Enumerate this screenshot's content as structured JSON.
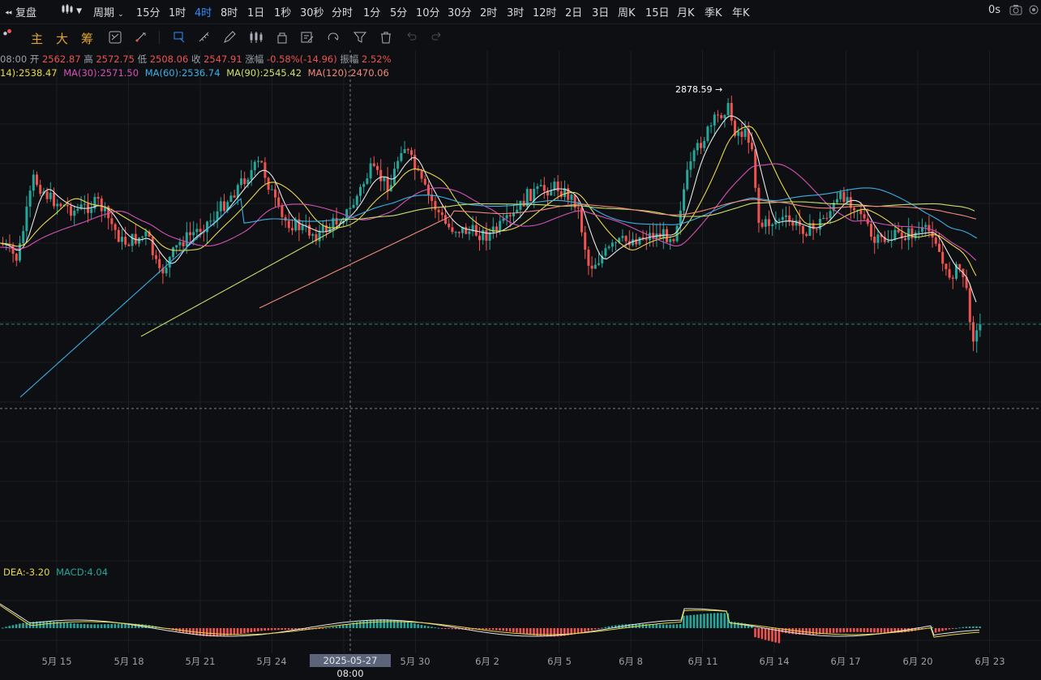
{
  "topbar": {
    "replay": "复盘",
    "period": "周期",
    "intervals": [
      "15分",
      "1时",
      "4时",
      "8时",
      "1日",
      "1秒",
      "30秒",
      "分时",
      "1分",
      "5分",
      "10分",
      "30分",
      "2时",
      "3时",
      "12时",
      "2日",
      "3日",
      "周K",
      "15日",
      "月K",
      "季K",
      "年K"
    ],
    "active_interval": "4时",
    "latency": "0s"
  },
  "toolbar": {
    "indicator_main": "主",
    "indicator_big": "大",
    "indicator_chip": "筹"
  },
  "info": {
    "time": "08:00",
    "open_label": "开",
    "open": "2562.87",
    "high_label": "高",
    "high": "2572.75",
    "low_label": "低",
    "low": "2508.06",
    "close_label": "收",
    "close": "2547.91",
    "chg_label": "涨幅",
    "chg": "-0.58%(-14.96)",
    "amp_label": "振幅",
    "amp": "2.52%"
  },
  "ma": {
    "ma_partial": "14):2538.47",
    "ma30": "MA(30):2571.50",
    "ma60": "MA(60):2536.74",
    "ma90": "MA(90):2545.42",
    "ma120": "MA(120):2470.06"
  },
  "macd": {
    "dea": "DEA:-3.20",
    "macd": "MACD:4.04"
  },
  "high_marker": "2878.59",
  "crosshair_time": "2025-05-27 08:00",
  "colors": {
    "up": "#26a69a",
    "down": "#ef5350",
    "accent": "#2f8cff",
    "bg": "#0e0f12"
  },
  "chart_data": {
    "type": "candlestick",
    "x_ticks": [
      "5月 15",
      "5月 18",
      "5月 21",
      "5月 24",
      "5月 30",
      "6月 2",
      "6月 5",
      "6月 8",
      "6月 11",
      "6月 14",
      "6月 17",
      "6月 20",
      "6月 23"
    ],
    "high_value": 2878.59,
    "last_close": 2547.91
  }
}
